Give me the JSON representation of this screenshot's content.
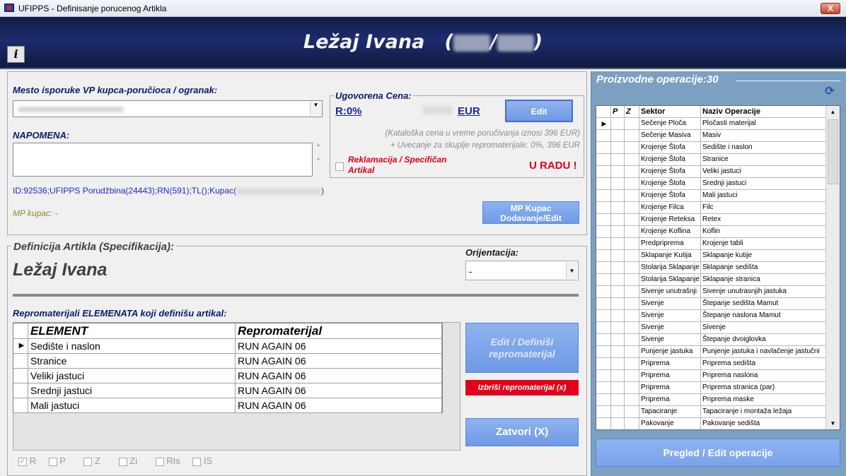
{
  "window": {
    "title": "UFIPPS - Definisanje porucenog Artikla",
    "close": "X"
  },
  "header": {
    "title_text": "Ležaj Ivana",
    "paren_open": "(",
    "slash": "/",
    "paren_close": ")",
    "info_label": "i"
  },
  "delivery": {
    "label": "Mesto isporuke VP kupca-poručioca / ogranak:",
    "note_label": "NAPOMENA:",
    "id_line_prefix": "ID:92536;UFIPPS Porudžbina(24443);RN(591);TL();Kupac(",
    "id_line_suffix": ")",
    "mp_kupac": "MP kupac:  -",
    "mp_button": "MP Kupac Dodavanje/Edit"
  },
  "price": {
    "label": "Ugovorena Cena:",
    "r_value": "R:0%",
    "currency": "EUR",
    "edit_button": "Edit",
    "catalog_note": "(Kataloška cena u vreme poručivanja iznosi 396 EUR)",
    "increase_note": "+ Uvecanje za skuplje repromaterijale: 0%,  396 EUR",
    "reclamation_label": "Reklamacija / Specifičan Artikal",
    "status": "U RADU !"
  },
  "definition": {
    "label": "Definicija Artikla (Specifikacija):",
    "article_name": "Ležaj Ivana",
    "orientation_label": "Orijentacija:",
    "orientation_value": "-",
    "repro_label": "Repromaterijali ELEMENATA koji definišu artikal:",
    "col_element": "ELEMENT",
    "col_repro": "Repromaterijal",
    "rows": [
      {
        "element": "Sedište i naslon",
        "repro": "RUN AGAIN 06"
      },
      {
        "element": "Stranice",
        "repro": "RUN AGAIN 06"
      },
      {
        "element": "Veliki jastuci",
        "repro": "RUN AGAIN 06"
      },
      {
        "element": "Srednji jastuci",
        "repro": "RUN AGAIN 06"
      },
      {
        "element": "Mali jastuci",
        "repro": "RUN AGAIN 06"
      }
    ],
    "edit_repro_button": "Edit / Definiši repromaterijal",
    "delete_repro_button": "Izbriši repromaterijal (x)",
    "close_button": "Zatvori (X)",
    "checks": [
      {
        "label": "R",
        "checked": true
      },
      {
        "label": "P",
        "checked": false
      },
      {
        "label": "Z",
        "checked": false
      },
      {
        "label": "Zi",
        "checked": false
      },
      {
        "label": "RIs",
        "checked": false
      },
      {
        "label": "IS",
        "checked": false
      }
    ]
  },
  "operations": {
    "title": "Proizvodne operacije:30",
    "col_p": "P",
    "col_z": "Z",
    "col_sektor": "Sektor",
    "col_naziv": "Naziv Operacije",
    "rows": [
      {
        "sektor": "Sečenje Ploča",
        "naziv": "Pločasti materijal"
      },
      {
        "sektor": "Sečenje Masiva",
        "naziv": "Masiv"
      },
      {
        "sektor": "Krojenje Štofa",
        "naziv": "Sedište i naslon"
      },
      {
        "sektor": "Krojenje Štofa",
        "naziv": "Stranice"
      },
      {
        "sektor": "Krojenje Štofa",
        "naziv": "Veliki jastuci"
      },
      {
        "sektor": "Krojenje Štofa",
        "naziv": "Srednji jastuci"
      },
      {
        "sektor": "Krojenje Štofa",
        "naziv": "Mali jastuci"
      },
      {
        "sektor": "Krojenje Filca",
        "naziv": "Filc"
      },
      {
        "sektor": "Krojenje Reteksa",
        "naziv": "Retex"
      },
      {
        "sektor": "Krojenje Koflina",
        "naziv": "Koflin"
      },
      {
        "sektor": "Predpriprema",
        "naziv": "Krojenje tabli"
      },
      {
        "sektor": "Sklapanje Kutija",
        "naziv": "Sklapanje kutije"
      },
      {
        "sektor": "Stolarija Sklapanje",
        "naziv": "Sklapanje sedišta"
      },
      {
        "sektor": "Stolarija Sklapanje",
        "naziv": "Sklapanje stranica"
      },
      {
        "sektor": "Sivenje unutrašnji",
        "naziv": "Sivenje unutrasnjih jastuka"
      },
      {
        "sektor": "Sivenje",
        "naziv": "Štepanje sedišta Mamut"
      },
      {
        "sektor": "Sivenje",
        "naziv": "Štepanje naslona Mamut"
      },
      {
        "sektor": "Sivenje",
        "naziv": "Sivenje"
      },
      {
        "sektor": "Sivenje",
        "naziv": "Štepanje dvoiglovka"
      },
      {
        "sektor": "Punjenje jastuka",
        "naziv": "Punjenje jastuka i navlačenje jastučni"
      },
      {
        "sektor": "Priprema",
        "naziv": "Priprema sedišta"
      },
      {
        "sektor": "Priprema",
        "naziv": "Priprema naslona"
      },
      {
        "sektor": "Priprema",
        "naziv": "Priprema stranica (par)"
      },
      {
        "sektor": "Priprema",
        "naziv": "Priprema maske"
      },
      {
        "sektor": "Tapaciranje",
        "naziv": "Tapaciranje i montaža ležaja"
      },
      {
        "sektor": "Pakovanje",
        "naziv": "Pakovanje sedišta"
      }
    ],
    "pregled_button": "Pregled / Edit operacije",
    "refresh_icon": "refresh-icon"
  }
}
